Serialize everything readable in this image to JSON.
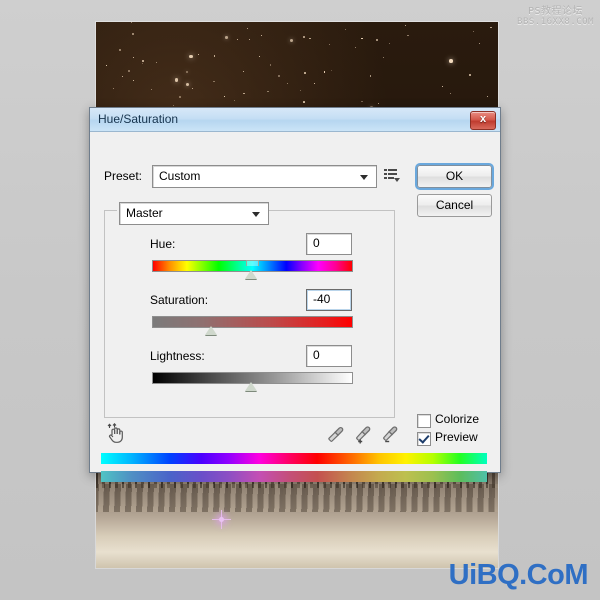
{
  "watermarks": {
    "top_line1": "PS教程论坛",
    "top_line2": "BBS.16XX8.COM",
    "bottom": "UiBQ.CoM"
  },
  "dialog": {
    "title": "Hue/Saturation",
    "close_label": "x",
    "preset": {
      "label": "Preset:",
      "value": "Custom",
      "menu_icon": "preset-options-menu-icon"
    },
    "buttons": {
      "ok": "OK",
      "cancel": "Cancel"
    },
    "channel": {
      "value": "Master"
    },
    "sliders": [
      {
        "label": "Hue:",
        "value": "0",
        "position_pct": 50,
        "focused": false
      },
      {
        "label": "Saturation:",
        "value": "-40",
        "position_pct": 30,
        "focused": true
      },
      {
        "label": "Lightness:",
        "value": "0",
        "position_pct": 50,
        "focused": false
      }
    ],
    "tools": {
      "targeted_adjustment": "on-image-adjustment-hand-icon",
      "eyedropper": "eyedropper-icon",
      "eyedropper_add": "eyedropper-plus-icon",
      "eyedropper_subtract": "eyedropper-minus-icon"
    },
    "checkboxes": [
      {
        "label": "Colorize",
        "checked": false
      },
      {
        "label": "Preview",
        "checked": true
      }
    ]
  },
  "colors": {
    "titlebar": "#c5def4",
    "close_button": "#d4594c",
    "focus_ring": "#6aa8dd",
    "dialog_bg": "#f0f0f0",
    "watermark_blue": "#2f6fc4"
  }
}
